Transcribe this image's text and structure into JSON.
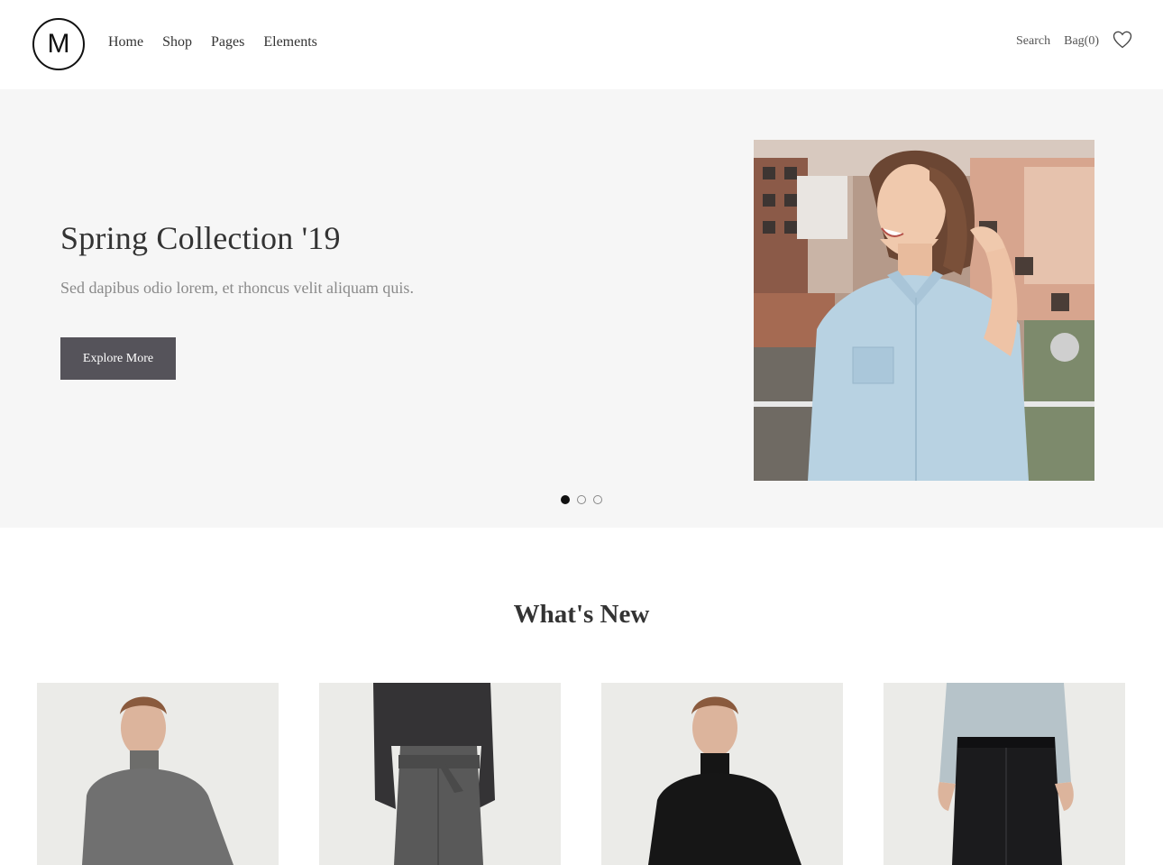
{
  "brand": {
    "logo_letter": "M"
  },
  "nav": {
    "items": [
      {
        "label": "Home"
      },
      {
        "label": "Shop"
      },
      {
        "label": "Pages"
      },
      {
        "label": "Elements"
      }
    ]
  },
  "utility": {
    "search_label": "Search",
    "bag_label": "Bag",
    "bag_count": "(0)"
  },
  "hero": {
    "title": "Spring Collection '19",
    "subtitle": "Sed dapibus odio lorem, et rhoncus velit aliquam quis.",
    "button_label": "Explore More",
    "slides_total": 3,
    "active_slide": 1
  },
  "whats_new": {
    "title": "What's New",
    "products": [
      {
        "image": "man-grey-turtleneck"
      },
      {
        "image": "woman-grey-trousers"
      },
      {
        "image": "man-black-turtleneck"
      },
      {
        "image": "man-black-trousers"
      }
    ]
  },
  "colors": {
    "hero_bg": "#f6f6f6",
    "button_bg": "#55535a",
    "text_primary": "#333333",
    "text_muted": "#8a8a8a"
  }
}
